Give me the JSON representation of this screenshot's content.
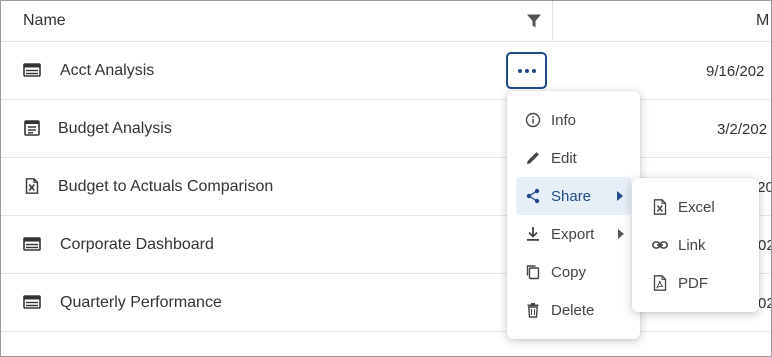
{
  "header": {
    "name_label": "Name",
    "next_column_label": "M"
  },
  "rows": [
    {
      "name": "Acct Analysis",
      "date": "9/16/202",
      "icon": "table-icon"
    },
    {
      "name": "Budget Analysis",
      "date": "3/2/202",
      "icon": "report-icon"
    },
    {
      "name": "Budget to Actuals Comparison",
      "date": "/20",
      "icon": "excel-file-icon"
    },
    {
      "name": "Corporate Dashboard",
      "date": "02",
      "icon": "table-icon"
    },
    {
      "name": "Quarterly Performance",
      "date": "02",
      "icon": "table-icon"
    }
  ],
  "context_menu": {
    "items": [
      {
        "label": "Info",
        "icon": "info-icon"
      },
      {
        "label": "Edit",
        "icon": "pencil-icon"
      },
      {
        "label": "Share",
        "icon": "share-icon",
        "has_submenu": true,
        "active": true
      },
      {
        "label": "Export",
        "icon": "download-icon",
        "has_submenu": true
      },
      {
        "label": "Copy",
        "icon": "copy-icon"
      },
      {
        "label": "Delete",
        "icon": "trash-icon"
      }
    ]
  },
  "share_submenu": {
    "items": [
      {
        "label": "Excel",
        "icon": "excel-icon"
      },
      {
        "label": "Link",
        "icon": "link-icon"
      },
      {
        "label": "PDF",
        "icon": "pdf-icon"
      }
    ]
  },
  "colors": {
    "accent": "#1f4a87",
    "active_bg": "#e6eef8",
    "text": "#333333",
    "divider": "#e6e6e6"
  }
}
